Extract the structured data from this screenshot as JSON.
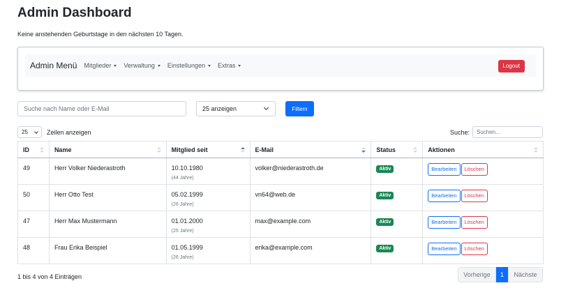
{
  "header": {
    "title": "Admin Dashboard",
    "birthday_note": "Keine anstehenden Geburtstage in den nächsten 10 Tagen."
  },
  "menu": {
    "brand": "Admin Menü",
    "items": [
      "Mitglieder",
      "Verwaltung",
      "Einstellungen",
      "Extras"
    ],
    "logout": "Logout"
  },
  "filter": {
    "search_placeholder": "Suche nach Name oder E-Mail",
    "per_page_value": "25 anzeigen",
    "filter_button": "Filtern"
  },
  "table_controls": {
    "length_value": "25",
    "length_label": "Zeilen anzeigen",
    "search_label": "Suche:",
    "search_placeholder": "Suchen..."
  },
  "table": {
    "columns": [
      "ID",
      "Name",
      "Mitglied seit",
      "E-Mail",
      "Status",
      "Aktionen"
    ],
    "rows": [
      {
        "id": "49",
        "name": "Herr Volker Niederastroth",
        "since": "10.10.1980",
        "years": "(44 Jahre)",
        "email": "volker@niederastroth.de",
        "status": "Aktiv",
        "edit": "Bearbeiten",
        "delete": "Löschen"
      },
      {
        "id": "50",
        "name": "Herr Otto Test",
        "since": "05.02.1999",
        "years": "(26 Jahre)",
        "email": "vn64@web.de",
        "status": "Aktiv",
        "edit": "Bearbeiten",
        "delete": "Löschen"
      },
      {
        "id": "47",
        "name": "Herr Max Mustermann",
        "since": "01.01.2000",
        "years": "(25 Jahre)",
        "email": "max@example.com",
        "status": "Aktiv",
        "edit": "Bearbeiten",
        "delete": "Löschen"
      },
      {
        "id": "48",
        "name": "Frau Erika Beispiel",
        "since": "01.05.1999",
        "years": "(26 Jahre)",
        "email": "erika@example.com",
        "status": "Aktiv",
        "edit": "Bearbeiten",
        "delete": "Löschen"
      }
    ]
  },
  "footer": {
    "info": "1 bis 4 von 4 Einträgen",
    "prev": "Vorherige",
    "page": "1",
    "next": "Nächste"
  },
  "colors": {
    "primary": "#0d6efd",
    "danger": "#dc3545",
    "success": "#198754"
  }
}
